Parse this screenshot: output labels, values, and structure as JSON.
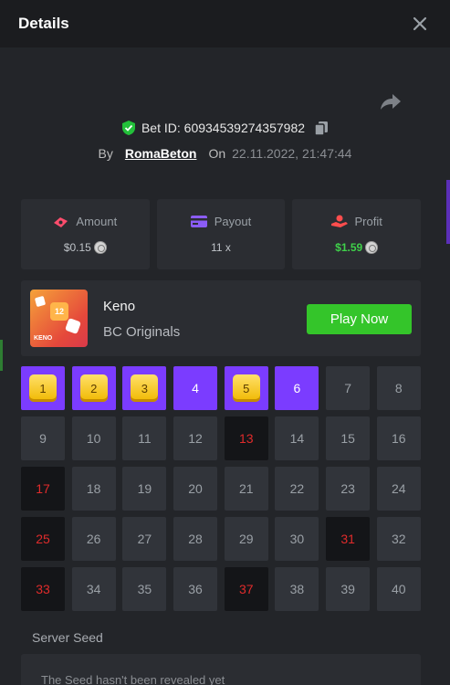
{
  "header": {
    "title": "Details"
  },
  "bet": {
    "label": "Bet ID: 60934539274357982"
  },
  "by": {
    "by_label": "By",
    "user": "RomaBeton",
    "on_label": "On",
    "date": "22.11.2022, 21:47:44"
  },
  "stats": [
    {
      "label": "Amount",
      "value": "$0.15",
      "icon": "money-icon",
      "color": "#ff4d6d"
    },
    {
      "label": "Payout",
      "value": "11 x",
      "icon": "card-icon",
      "color": "#8b5cf6"
    },
    {
      "label": "Profit",
      "value": "$1.59",
      "icon": "hand-coin-icon",
      "color": "#ff4d4d"
    }
  ],
  "game": {
    "name": "Keno",
    "provider": "BC Originals",
    "thumb_label": "KENO",
    "thumb_number": "12",
    "play_label": "Play Now"
  },
  "grid": [
    {
      "n": "1",
      "state": "hit"
    },
    {
      "n": "2",
      "state": "hit"
    },
    {
      "n": "3",
      "state": "hit"
    },
    {
      "n": "4",
      "state": "pick"
    },
    {
      "n": "5",
      "state": "hit"
    },
    {
      "n": "6",
      "state": "pick"
    },
    {
      "n": "7",
      "state": "normal"
    },
    {
      "n": "8",
      "state": "normal"
    },
    {
      "n": "9",
      "state": "normal"
    },
    {
      "n": "10",
      "state": "normal"
    },
    {
      "n": "11",
      "state": "normal"
    },
    {
      "n": "12",
      "state": "normal"
    },
    {
      "n": "13",
      "state": "drawn"
    },
    {
      "n": "14",
      "state": "normal"
    },
    {
      "n": "15",
      "state": "normal"
    },
    {
      "n": "16",
      "state": "normal"
    },
    {
      "n": "17",
      "state": "drawn"
    },
    {
      "n": "18",
      "state": "normal"
    },
    {
      "n": "19",
      "state": "normal"
    },
    {
      "n": "20",
      "state": "normal"
    },
    {
      "n": "21",
      "state": "normal"
    },
    {
      "n": "22",
      "state": "normal"
    },
    {
      "n": "23",
      "state": "normal"
    },
    {
      "n": "24",
      "state": "normal"
    },
    {
      "n": "25",
      "state": "drawn"
    },
    {
      "n": "26",
      "state": "normal"
    },
    {
      "n": "27",
      "state": "normal"
    },
    {
      "n": "28",
      "state": "normal"
    },
    {
      "n": "29",
      "state": "normal"
    },
    {
      "n": "30",
      "state": "normal"
    },
    {
      "n": "31",
      "state": "drawn"
    },
    {
      "n": "32",
      "state": "normal"
    },
    {
      "n": "33",
      "state": "drawn"
    },
    {
      "n": "34",
      "state": "normal"
    },
    {
      "n": "35",
      "state": "normal"
    },
    {
      "n": "36",
      "state": "normal"
    },
    {
      "n": "37",
      "state": "drawn"
    },
    {
      "n": "38",
      "state": "normal"
    },
    {
      "n": "39",
      "state": "normal"
    },
    {
      "n": "40",
      "state": "normal"
    }
  ],
  "seed": {
    "label": "Server Seed",
    "text": "The Seed hasn't been revealed yet"
  }
}
